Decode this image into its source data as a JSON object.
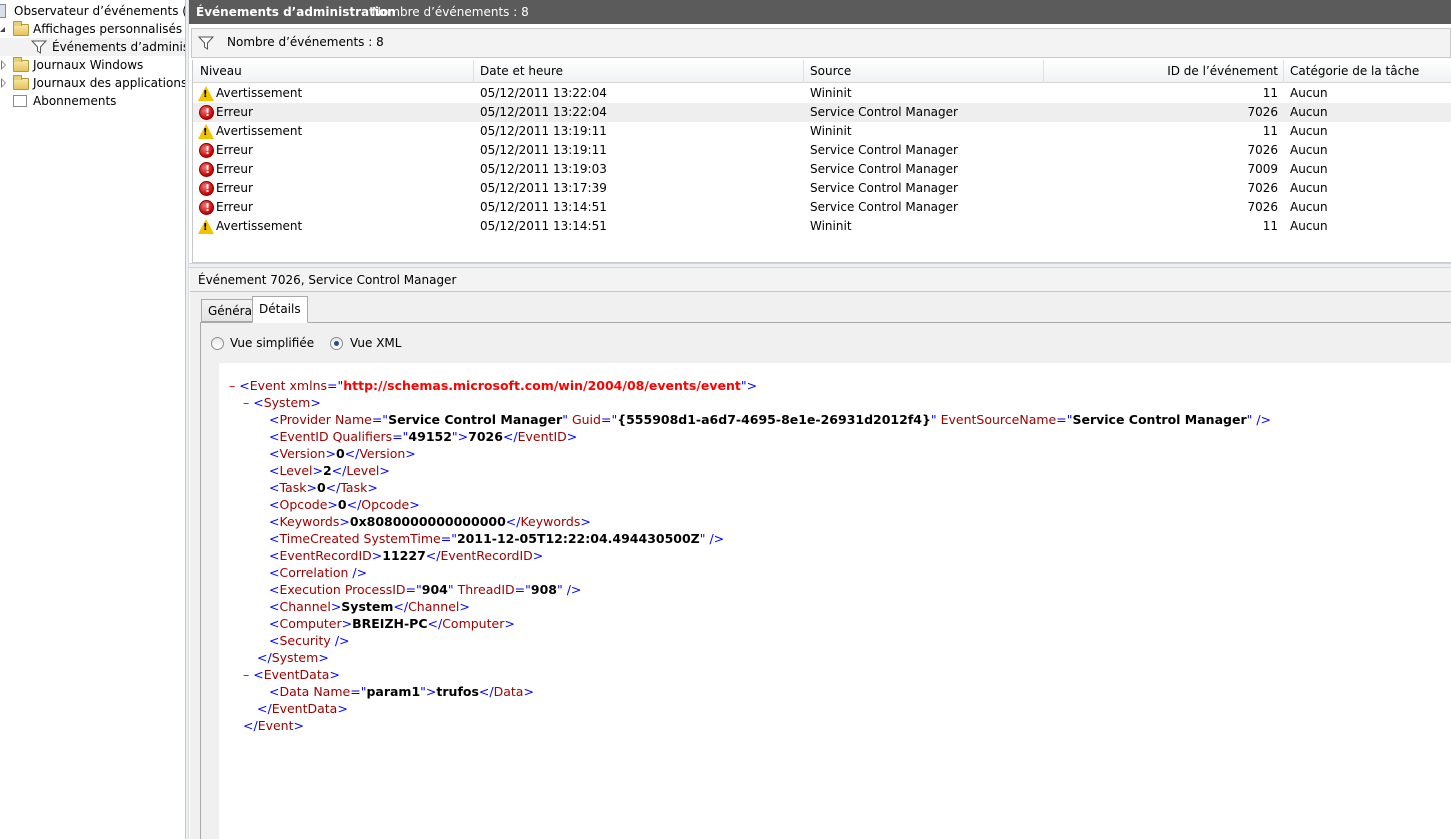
{
  "tree": {
    "root": "Observateur d’événements (Local)",
    "custom_views": "Affichages personnalisés",
    "admin_events": "Événements d’administration",
    "windows_logs": "Journaux Windows",
    "app_logs": "Journaux des applications et de services",
    "subscriptions": "Abonnements"
  },
  "titlebar": {
    "title": "Événements d’administration",
    "count": "Nombre d’événements : 8"
  },
  "filterbar": {
    "label": "Nombre d’événements : 8"
  },
  "columns": [
    "Niveau",
    "Date et heure",
    "Source",
    "ID de l’événement",
    "Catégorie de la tâche"
  ],
  "events": [
    {
      "level": "Avertissement",
      "type": "warning",
      "date": "05/12/2011 13:22:04",
      "source": "Wininit",
      "id": "11",
      "category": "Aucun"
    },
    {
      "level": "Erreur",
      "type": "error",
      "date": "05/12/2011 13:22:04",
      "source": "Service Control Manager",
      "id": "7026",
      "category": "Aucun"
    },
    {
      "level": "Avertissement",
      "type": "warning",
      "date": "05/12/2011 13:19:11",
      "source": "Wininit",
      "id": "11",
      "category": "Aucun"
    },
    {
      "level": "Erreur",
      "type": "error",
      "date": "05/12/2011 13:19:11",
      "source": "Service Control Manager",
      "id": "7026",
      "category": "Aucun"
    },
    {
      "level": "Erreur",
      "type": "error",
      "date": "05/12/2011 13:19:03",
      "source": "Service Control Manager",
      "id": "7009",
      "category": "Aucun"
    },
    {
      "level": "Erreur",
      "type": "error",
      "date": "05/12/2011 13:17:39",
      "source": "Service Control Manager",
      "id": "7026",
      "category": "Aucun"
    },
    {
      "level": "Erreur",
      "type": "error",
      "date": "05/12/2011 13:14:51",
      "source": "Service Control Manager",
      "id": "7026",
      "category": "Aucun"
    },
    {
      "level": "Avertissement",
      "type": "warning",
      "date": "05/12/2011 13:14:51",
      "source": "Wininit",
      "id": "11",
      "category": "Aucun"
    }
  ],
  "detail": {
    "header": "Événement 7026, Service Control Manager",
    "tab_general": "Général",
    "tab_details": "Détails",
    "radio_simple": "Vue simplifiée",
    "radio_xml": "Vue XML"
  },
  "xml": {
    "event_xmlns": "http://schemas.microsoft.com/win/2004/08/events/event",
    "provider_name": "Service Control Manager",
    "provider_guid": "{555908d1-a6d7-4695-8e1e-26931d2012f4}",
    "event_source_name": "Service Control Manager",
    "qualifiers": "49152",
    "event_id": "7026",
    "version": "0",
    "level": "2",
    "task": "0",
    "opcode": "0",
    "keywords": "0x8080000000000000",
    "system_time": "2011-12-05T12:22:04.494430500Z",
    "record_id": "11227",
    "process_id": "904",
    "thread_id": "908",
    "channel": "System",
    "computer": "BREIZH-PC",
    "data_name": "param1",
    "data_value": "trufos"
  }
}
